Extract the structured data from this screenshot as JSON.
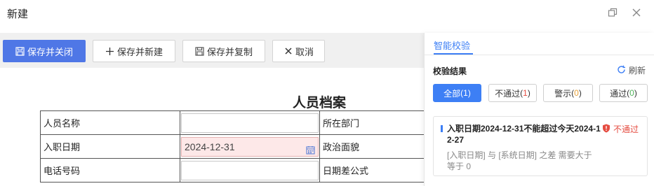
{
  "window": {
    "title": "新建"
  },
  "toolbar": {
    "save_close": "保存并关闭",
    "save_new": "保存并新建",
    "save_copy": "保存并复制",
    "cancel": "取消"
  },
  "form": {
    "title": "人员档案",
    "rows": [
      {
        "left_label": "人员名称",
        "left_value": "",
        "right_label": "所在部门"
      },
      {
        "left_label": "入职日期",
        "left_value": "2024-12-31",
        "right_label": "政治面貌"
      },
      {
        "left_label": "电话号码",
        "left_value": "",
        "right_label": "日期差公式"
      }
    ]
  },
  "panel": {
    "tab": "智能校验",
    "section_title": "校验结果",
    "refresh": "刷新",
    "filters": [
      {
        "label": "全部",
        "count": "1"
      },
      {
        "label": "不通过",
        "count": "1"
      },
      {
        "label": "警示",
        "count": "0"
      },
      {
        "label": "通过",
        "count": "0"
      }
    ],
    "result": {
      "message": "入职日期2024-12-31不能超过今天2024-12-27",
      "status": "不通过",
      "description": "[入职日期] 与 [系统日期] 之差 需要大于等于 0"
    }
  },
  "colors": {
    "primary": "#4f77e6",
    "accent": "#3d7ff5",
    "error": "#e54d42",
    "error_field_bg": "#fde8e8"
  }
}
